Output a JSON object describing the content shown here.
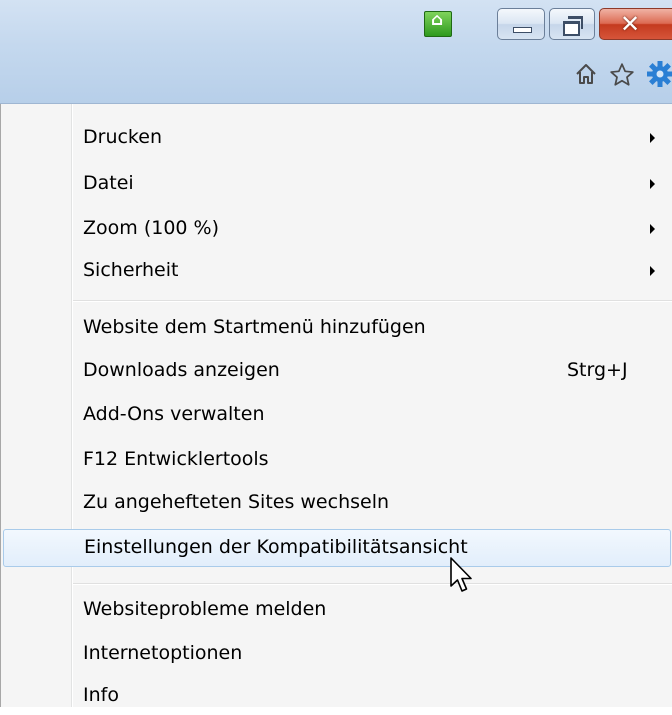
{
  "window": {
    "minimize_icon": "minimize-icon",
    "restore_icon": "restore-icon",
    "close_icon": "close-icon",
    "addon_icon": "green-addon-icon"
  },
  "toolbar": {
    "icons": [
      "home-icon",
      "star-icon",
      "gear-icon"
    ]
  },
  "menu": {
    "group1": [
      {
        "label": "Drucken",
        "submenu": true
      },
      {
        "label": "Datei",
        "submenu": true
      },
      {
        "label": "Zoom (100 %)",
        "submenu": true
      },
      {
        "label": "Sicherheit",
        "submenu": true
      }
    ],
    "group2": [
      {
        "label": "Website dem Startmenü hinzufügen"
      },
      {
        "label": "Downloads anzeigen",
        "shortcut": "Strg+J"
      },
      {
        "label": "Add-Ons verwalten"
      },
      {
        "label": "F12 Entwicklertools"
      },
      {
        "label": "Zu angehefteten Sites wechseln"
      },
      {
        "label": "Einstellungen der Kompatibilitätsansicht",
        "highlighted": true
      }
    ],
    "group3": [
      {
        "label": "Websiteprobleme melden"
      },
      {
        "label": "Internetoptionen"
      },
      {
        "label": "Info"
      }
    ]
  },
  "colors": {
    "titlebar": "#c4d8ee",
    "gear": "#2a7fd4",
    "highlight_border": "#a9cbea"
  }
}
